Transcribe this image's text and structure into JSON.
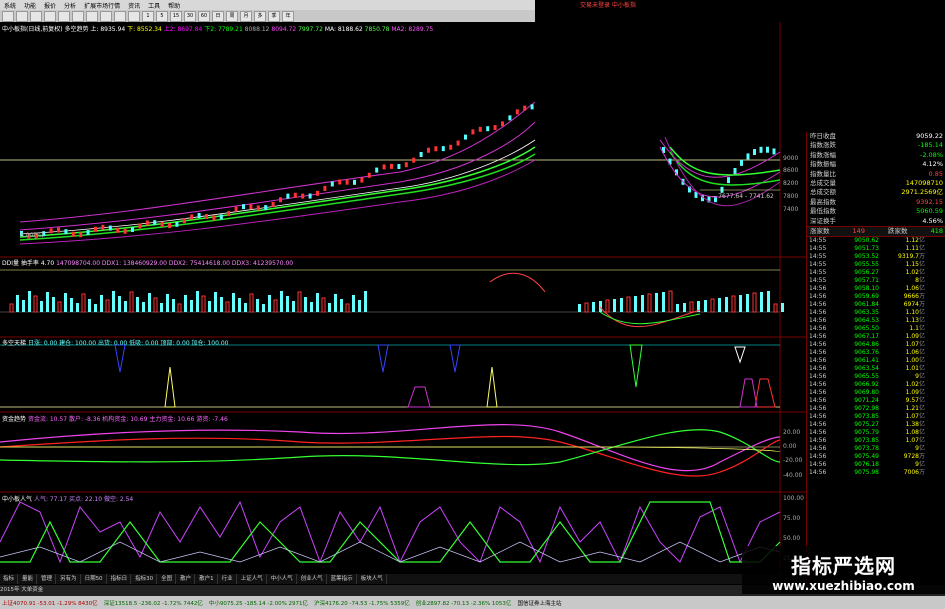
{
  "menubar": {
    "items": [
      "系统",
      "功能",
      "报价",
      "分析",
      "扩展市场行情",
      "资讯",
      "工具",
      "帮助"
    ]
  },
  "toolbar": {
    "periods": [
      "1",
      "5",
      "15",
      "30",
      "60",
      "日",
      "周",
      "月",
      "多",
      "季",
      "年"
    ]
  },
  "header": {
    "right_text": "交易未登录  中小板指"
  },
  "main_chart": {
    "title": "中小板指(日线,前复权) 多空趋势",
    "ma_labels": [
      {
        "text": "上: 8935.94",
        "color": "#ffffff"
      },
      {
        "text": "下: 8552.34",
        "color": "#ffff00"
      },
      {
        "text": "上2: 8697.84",
        "color": "#ff00ff"
      },
      {
        "text": "下2: 7789.21",
        "color": "#00ff00"
      },
      {
        "text": "8088.12",
        "color": "#aaaaaa"
      },
      {
        "text": "8094.72",
        "color": "#ff44ff"
      },
      {
        "text": "7997.72",
        "color": "#44ff44"
      },
      {
        "text": "MA: 8188.62",
        "color": "#ffffff"
      },
      {
        "text": "7850.78",
        "color": "#55ff55"
      },
      {
        "text": "MA2: 8289.75",
        "color": "#ff55ff"
      }
    ],
    "price_marks": [
      "-- 7677.64 - 7741.62"
    ],
    "left_tag": "8.00(%)"
  },
  "quote_panel": {
    "rows": [
      {
        "label": "昨日收盘",
        "value": "9059.22",
        "color": "#ffffff"
      },
      {
        "label": "指数涨跌",
        "value": "-185.14",
        "color": "#00ff00"
      },
      {
        "label": "指数涨幅",
        "value": "-2.08%",
        "color": "#00ff00"
      },
      {
        "label": "指数振幅",
        "value": "4.12%",
        "color": "#ffffff"
      },
      {
        "label": "指数量比",
        "value": "0.85",
        "color": "#ff4444"
      },
      {
        "label": "总成交量",
        "value": "147098710",
        "color": "#ffff00"
      },
      {
        "label": "总成交额",
        "value": "2971.2569亿",
        "color": "#ffff00"
      },
      {
        "label": "最高指数",
        "value": "9392.15",
        "color": "#ff4444"
      },
      {
        "label": "最低指数",
        "value": "5060.59",
        "color": "#00ff00"
      },
      {
        "label": "深证换手",
        "value": "4.56%",
        "color": "#ffffff"
      }
    ],
    "updown": {
      "up_label": "涨家数",
      "up_value": "149",
      "down_label": "跌家数",
      "down_value": "418"
    },
    "ticks": [
      {
        "t": "14:55",
        "p": "9050.62",
        "v": "1.12",
        "u": "亿"
      },
      {
        "t": "14:55",
        "p": "9051.73",
        "v": "1.11",
        "u": "亿"
      },
      {
        "t": "14:55",
        "p": "9053.52",
        "v": "9319.7",
        "u": "万"
      },
      {
        "t": "14:55",
        "p": "9055.55",
        "v": "1.15",
        "u": "亿"
      },
      {
        "t": "14:55",
        "p": "9056.27",
        "v": "1.02",
        "u": "亿"
      },
      {
        "t": "14:55",
        "p": "9057.71",
        "v": "8",
        "u": "亿"
      },
      {
        "t": "14:56",
        "p": "9058.10",
        "v": "1.06",
        "u": "亿"
      },
      {
        "t": "14:56",
        "p": "9059.69",
        "v": "9666",
        "u": "万"
      },
      {
        "t": "14:56",
        "p": "9061.84",
        "v": "6974",
        "u": "万"
      },
      {
        "t": "14:56",
        "p": "9063.35",
        "v": "1.10",
        "u": "亿"
      },
      {
        "t": "14:56",
        "p": "9064.53",
        "v": "1.13",
        "u": "亿"
      },
      {
        "t": "14:56",
        "p": "9065.50",
        "v": "1.1",
        "u": "亿"
      },
      {
        "t": "14:56",
        "p": "9067.17",
        "v": "1.09",
        "u": "亿"
      },
      {
        "t": "14:56",
        "p": "9064.86",
        "v": "1.07",
        "u": "亿"
      },
      {
        "t": "14:56",
        "p": "9063.76",
        "v": "1.06",
        "u": "亿"
      },
      {
        "t": "14:56",
        "p": "9061.41",
        "v": "1.00",
        "u": "亿"
      },
      {
        "t": "14:56",
        "p": "9063.54",
        "v": "1.01",
        "u": "亿"
      },
      {
        "t": "14:56",
        "p": "9065.55",
        "v": "9",
        "u": "亿"
      },
      {
        "t": "14:56",
        "p": "9066.92",
        "v": "1.02",
        "u": "亿"
      },
      {
        "t": "14:56",
        "p": "9069.80",
        "v": "1.09",
        "u": "亿"
      },
      {
        "t": "14:56",
        "p": "9071.24",
        "v": "9.57",
        "u": "亿"
      },
      {
        "t": "14:56",
        "p": "9072.98",
        "v": "1.21",
        "u": "亿"
      },
      {
        "t": "14:56",
        "p": "9073.85",
        "v": "1.07",
        "u": "亿"
      },
      {
        "t": "14:56",
        "p": "9075.27",
        "v": "1.38",
        "u": "亿"
      },
      {
        "t": "14:56",
        "p": "9075.79",
        "v": "1.08",
        "u": "亿"
      },
      {
        "t": "14:56",
        "p": "9073.85",
        "v": "1.07",
        "u": "亿"
      },
      {
        "t": "14:56",
        "p": "9073.78",
        "v": "9",
        "u": "亿"
      },
      {
        "t": "14:56",
        "p": "9075.49",
        "v": "9728",
        "u": "万"
      },
      {
        "t": "14:56",
        "p": "9076.18",
        "v": "9",
        "u": "亿"
      },
      {
        "t": "14:56",
        "p": "9075.98",
        "v": "7006",
        "u": "万"
      }
    ]
  },
  "indicators": [
    {
      "title": "DDI量 抽手率 4.70",
      "extra": "147098704.00   DDX1: 138460929.00   DDX2: 75414618.00   DDX3: 41239570.00"
    },
    {
      "title": "多空天梯",
      "extra": "日涨: 0.00   建仓: 100.00   出货: 0.00   低吸: 0.00   顶部: 0.00   加仓: 100.00"
    },
    {
      "title": "资金趋势",
      "extra": "资金流: 10.57   散户: -8.36   机构资金: 10.69   主力资金: 10.66   游资: -7.46"
    },
    {
      "title": "中小板人气",
      "extra": "人气: 77.17   买点: 22.10   做空: 2.54"
    }
  ],
  "tabs": [
    "指标",
    "量能",
    "管理",
    "另有为",
    "日期50",
    "指标日",
    "指标30",
    "全图",
    "散户",
    "散户1",
    "行业",
    "上证人气",
    "中小人气",
    "创业人气",
    "蓝筹指示",
    "板块人气"
  ],
  "sub_status": "2015年  大单资金",
  "status": [
    {
      "text": "上证4070.91 -53.01 -1.29% 8430亿",
      "color": "#aa0000"
    },
    {
      "text": "深证13518.5 -236.02 -1.72% 7442亿",
      "color": "#006600"
    },
    {
      "text": "中小9075.25 -185.14 -2.00% 2971亿",
      "color": "#006600"
    },
    {
      "text": "沪深4176.20 -74.53 -1.75% 5359亿",
      "color": "#006600"
    },
    {
      "text": "创业2897.82 -70.13 -2.36% 1053亿",
      "color": "#006600"
    },
    {
      "text": "国信证券上海主站",
      "color": "#000000"
    }
  ],
  "watermark": {
    "line1": "指标严选网",
    "line2": "www.xuezhibiao.com"
  }
}
